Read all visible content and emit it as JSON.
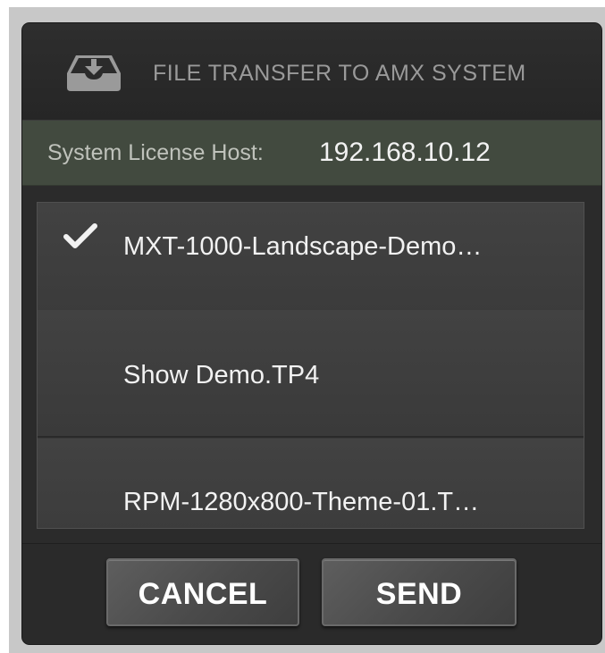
{
  "dialog": {
    "title": "FILE TRANSFER TO AMX SYSTEM",
    "icon": "download-tray-icon"
  },
  "host": {
    "label": "System License Host:",
    "value": "192.168.10.12"
  },
  "files": [
    {
      "name": "MXT-1000-Landscape-Demo…",
      "selected": true
    },
    {
      "name": "Show Demo.TP4",
      "selected": false
    },
    {
      "name": "RPM-1280x800-Theme-01.T…",
      "selected": false
    }
  ],
  "buttons": {
    "cancel_label": "CANCEL",
    "send_label": "SEND"
  },
  "colors": {
    "dialog_bg": "#2b2b2b",
    "host_bar_bg": "#424a3f",
    "list_item_bg": "#3e3e3e",
    "text_primary": "#f2f2f2",
    "text_muted": "#9a9a9a"
  }
}
